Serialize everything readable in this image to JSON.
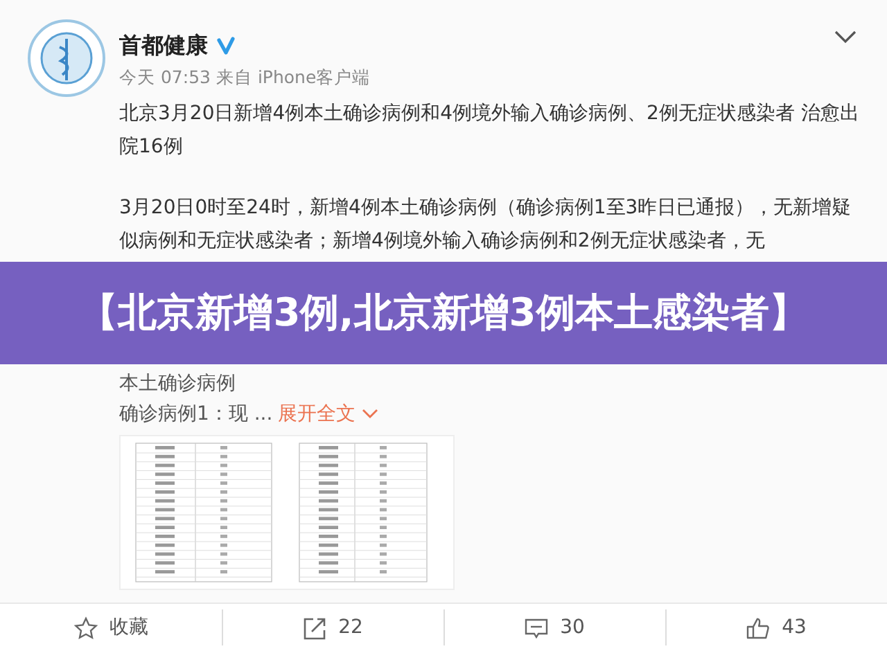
{
  "post": {
    "author": "首都健康",
    "verified": true,
    "meta": "今天 07:53 来自 iPhone客户端",
    "paragraphs": [
      "北京3月20日新增4例本土确诊病例和4例境外输入确诊病例、2例无症状感染者 治愈出院16例",
      "3月20日0时至24时，新增4例本土确诊病例（确诊病例1至3昨日已通报），无新增疑似病例和无症状感染者；新增4例境外输入确诊病例和2例无症状感染者，无"
    ],
    "section_title": "本土确诊病例",
    "excerpt": "确诊病例1：现 ...",
    "expand_link": "展开全文"
  },
  "banner": {
    "title": "【北京新增3例,北京新增3例本土感染者】"
  },
  "actions": [
    {
      "kind": "favorite",
      "label": "收藏"
    },
    {
      "kind": "repost",
      "label": "22"
    },
    {
      "kind": "comment",
      "label": "30"
    },
    {
      "kind": "like",
      "label": "43"
    }
  ]
}
